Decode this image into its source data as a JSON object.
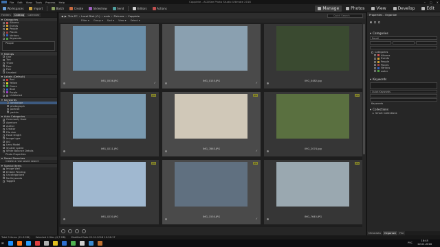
{
  "app": {
    "title": "Coppinte - ACDSee Photo Studio Ultimate 2018",
    "menu": [
      "File",
      "Edit",
      "View",
      "Tools",
      "Process",
      "Help"
    ]
  },
  "toolbar": {
    "tools": [
      {
        "label": "Workspaces",
        "icon": "workspaces-icon",
        "color": "#6aa0d8"
      },
      {
        "label": "Import",
        "icon": "import-icon",
        "color": "#c8a040"
      },
      {
        "label": "Batch",
        "icon": "batch-icon",
        "color": "#8aa060"
      },
      {
        "label": "Create",
        "icon": "create-icon",
        "color": "#c86a40"
      },
      {
        "label": "Slideshow",
        "icon": "slideshow-icon",
        "color": "#a060c0"
      },
      {
        "label": "Send",
        "icon": "send-icon",
        "color": "#50a0a0"
      },
      {
        "label": "Editors",
        "icon": "editors-icon",
        "color": "#d0d0d0"
      },
      {
        "label": "Actions",
        "icon": "actions-icon",
        "color": "#c05050"
      }
    ],
    "modes": [
      {
        "label": "Manage",
        "icon": "manage-icon",
        "active": true
      },
      {
        "label": "Photos",
        "icon": "photos-icon",
        "active": false
      },
      {
        "label": "View",
        "icon": "view-icon",
        "active": false
      },
      {
        "label": "Develop",
        "icon": "develop-icon",
        "active": false
      },
      {
        "label": "Edit",
        "icon": "edit-icon",
        "active": false
      }
    ]
  },
  "left_panel": {
    "tabs": [
      "Folders",
      "Catalog",
      "Calendar"
    ],
    "categories_header": "Categories",
    "categories": [
      "Albums",
      "Events",
      "People",
      "Places",
      "Various",
      "Keywords"
    ],
    "category_colors": [
      "#d05050",
      "#d0a030",
      "#d0a030",
      "#a04040",
      "#3060c0",
      "#50a040"
    ],
    "people_label": "People",
    "ratings_header": "Ratings",
    "ratings": [
      "One",
      "Two",
      "Three",
      "Four",
      "Five",
      "Unrated"
    ],
    "labels_header": "Labels (Default)",
    "labels": [
      "Red",
      "Yellow",
      "Green",
      "Blue",
      "Purple",
      "Unlabeled"
    ],
    "label_colors": [
      "#d03030",
      "#e0d030",
      "#40b040",
      "#3060d0",
      "#a040c0",
      "#777777"
    ],
    "keywords_header": "Keywords",
    "keywords": [
      "landscape",
      "photograph",
      "portrait",
      "yachts"
    ],
    "auto_header": "Auto Categories",
    "auto": [
      "Commonly Used",
      "Aperture",
      "Author",
      "Creator",
      "File size",
      "Focal length",
      "Image type",
      "ISO",
      "Lens Model",
      "Shutter speed",
      "White Balance Details"
    ],
    "photo_props": "Photo Properties",
    "saved_header": "Saved Searches",
    "saved_create": "Create a new saved search",
    "special_header": "Special Items",
    "special": [
      "Image Well",
      "Embed Pending",
      "Uncategorized",
      "No Keywords",
      "Tagged"
    ]
  },
  "pathbar": {
    "crumbs": [
      "This PC",
      "Local Disk (C:)",
      "acds",
      "Pictures",
      "Coppinte"
    ],
    "quick_search": "Quick Search"
  },
  "filterbar": [
    "Filter",
    "Group",
    "Sort",
    "View",
    "Select"
  ],
  "grid": {
    "files": [
      "IMG_0536.JPG",
      "IMG_0155.JPG",
      "IMG_0482.jpg",
      "IMG_0211.JPG",
      "IMG_7863.JPG",
      "IMG_2074.jpg",
      "IMG_0230.JPG",
      "IMG_1530.JPG",
      "IMG_7645.JPG"
    ],
    "badge": "JPG",
    "thumb_colors": [
      "#6a8ea8",
      "#8aa0b0",
      "#3a4a30",
      "#7a9ab0",
      "#d0c8b8",
      "#5a7040",
      "#a0b8d0",
      "#607080",
      "#9aa8b0"
    ]
  },
  "right_panel": {
    "header": "Properties - Organize",
    "categories_title": "Categories",
    "recall_label": "Recall",
    "categories": [
      "Albums",
      "Events",
      "People",
      "Places",
      "Various",
      "water"
    ],
    "category_colors": [
      "#d05050",
      "#d0a030",
      "#d0a030",
      "#a04040",
      "#3060c0",
      "#50a040"
    ],
    "categories_group": "Categories",
    "keywords_title": "Keywords",
    "keywords_tags": "Keywords",
    "quick_keywords": "Quick Keywords",
    "collections_title": "Collections",
    "smart_collections": "Smart Collections",
    "bottom_tabs": [
      "Metadata",
      "Organize",
      "File"
    ]
  },
  "status": {
    "total": "Total 9 items (21.8 MB)",
    "selected": "Selected 4 files (4,7 MB)",
    "date": "Modified Date 22.01.2018 10:26:17"
  },
  "taskbar": {
    "apps": [
      "#1e90ff",
      "#ff7a1a",
      "#2aa0ff",
      "#e04040",
      "#b0b0b0",
      "#e0c020",
      "#2f6fd0",
      "#50b050",
      "#d0d0d0",
      "#3a8ad0",
      "#c07030"
    ],
    "tray": "РУС",
    "time": "18:45",
    "date": "22.01.2018"
  }
}
